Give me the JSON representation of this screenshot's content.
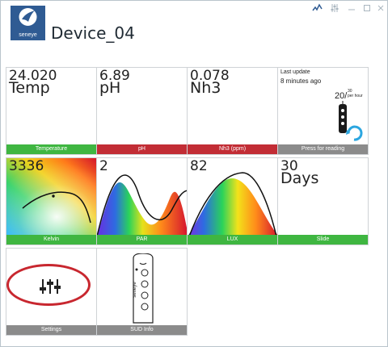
{
  "app": {
    "logo_text": "seneye",
    "device_name": "Device_04"
  },
  "window_controls": [
    {
      "name": "activity-icon",
      "glyph": "〰"
    },
    {
      "name": "settings-sliders-icon",
      "glyph": "⚙"
    },
    {
      "name": "minimize-icon",
      "glyph": "—"
    },
    {
      "name": "maximize-icon",
      "glyph": "□"
    },
    {
      "name": "close-icon",
      "glyph": "✕"
    }
  ],
  "tiles": {
    "temperature": {
      "value": "24.020",
      "unit": "Temp",
      "label": "Temperature",
      "bar_color": "#3fb641"
    },
    "ph": {
      "value": "6.89",
      "unit": "pH",
      "label": "pH",
      "bar_color": "#c22d35"
    },
    "nh3": {
      "value": "0.078",
      "unit": "Nh3",
      "label": "Nh3 (ppm)",
      "bar_color": "#c22d35"
    },
    "reading": {
      "last_update_label": "Last update",
      "last_update_value": "8 minutes ago",
      "rate": "20/",
      "rate_sup_top": "30",
      "rate_sup_bottom": "per hour",
      "label": "Press for reading",
      "bar_color": "#8b8b8b"
    },
    "kelvin": {
      "value": "3336",
      "label": "Kelvin",
      "bar_color": "#3fb641"
    },
    "par": {
      "value": "2",
      "label": "PAR",
      "bar_color": "#3fb641"
    },
    "lux": {
      "value": "82",
      "label": "LUX",
      "bar_color": "#3fb641"
    },
    "slide": {
      "value": "30",
      "unit": "Days",
      "label": "Slide",
      "bar_color": "#3fb641"
    },
    "settings": {
      "label": "Settings",
      "bar_color": "#8b8b8b"
    },
    "sud_info": {
      "label": "SUD Info",
      "device_text": "seneye",
      "bar_color": "#8b8b8b"
    }
  }
}
